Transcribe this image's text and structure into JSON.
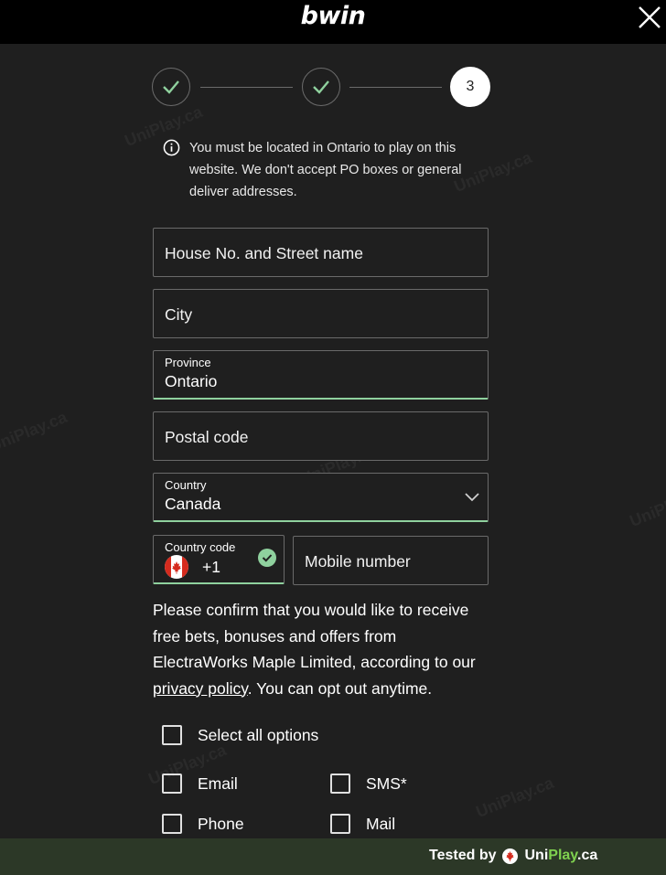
{
  "header": {
    "logo_text": "bwin",
    "close_icon": "close-icon"
  },
  "stepper": {
    "steps": [
      {
        "state": "complete",
        "icon": "check-icon"
      },
      {
        "state": "complete",
        "icon": "check-icon"
      },
      {
        "state": "current",
        "label": "3"
      }
    ],
    "accent_color": "#8fd19e"
  },
  "notice": {
    "icon": "info-icon",
    "text": "You must be located in Ontario to play on this website. We don't accept PO boxes or general deliver addresses."
  },
  "form": {
    "street": {
      "placeholder": "House No. and Street name"
    },
    "city": {
      "placeholder": "City"
    },
    "province": {
      "label": "Province",
      "value": "Ontario"
    },
    "postal": {
      "placeholder": "Postal code"
    },
    "country": {
      "label": "Country",
      "value": "Canada",
      "icon": "chevron-down-icon"
    },
    "country_code": {
      "label": "Country code",
      "value": "+1",
      "flag": "canada-flag-icon",
      "status_icon": "check-circle-icon"
    },
    "mobile": {
      "placeholder": "Mobile number"
    }
  },
  "consent": {
    "text_before": "Please confirm that you would like to receive free bets, bonuses and offers from ElectraWorks Maple Limited, according to our ",
    "link_text": "privacy policy",
    "text_after": ". You can opt out anytime.",
    "options": {
      "select_all": "Select all options",
      "email": "Email",
      "sms": "SMS*",
      "phone": "Phone",
      "mail": "Mail"
    }
  },
  "footer": {
    "tested_by": "Tested by",
    "brand_uni": "Uni",
    "brand_play": "Play",
    "brand_ca": ".ca",
    "icon": "maple-leaf-icon"
  },
  "watermark": "UniPlay.ca"
}
